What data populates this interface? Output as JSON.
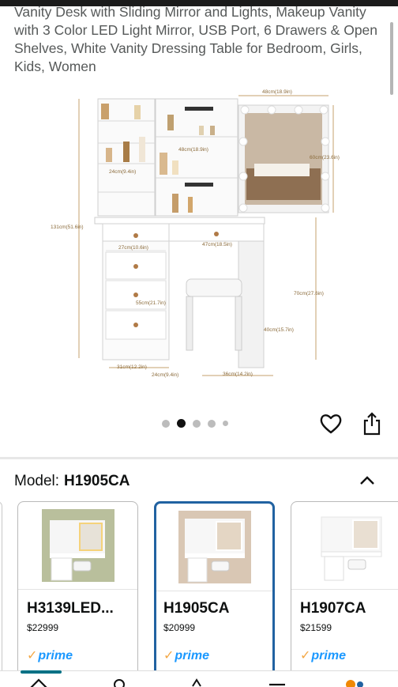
{
  "product": {
    "title": "Vanity Desk with Sliding Mirror and Lights, Makeup Vanity with 3 Color LED Light Mirror, USB Port, 6 Drawers & Open Shelves, White Vanity Dressing Table for Bedroom, Girls, Kids, Women"
  },
  "image_dimensions": {
    "top_width": "48cm(18.9in)",
    "mirror_height": "60cm(23.6in)",
    "shelf_width": "48cm(18.9in)",
    "shelf_depth": "24cm(9.4in)",
    "total_height": "131cm(51.6in)",
    "drawer_width": "27cm(10.6in)",
    "desk_drawer_width": "47cm(18.5in)",
    "desk_height": "70cm(27.6in)",
    "cabinet_height": "55cm(21.7in)",
    "stool_height": "40cm(15.7in)",
    "base_width": "31cm(12.2in)",
    "base_depth": "24cm(9.4in)",
    "stool_width": "36cm(14.2in)"
  },
  "carousel": {
    "count": 5,
    "active_index": 1
  },
  "actions": {
    "wishlist_icon": "heart-icon",
    "share_icon": "share-icon"
  },
  "model": {
    "label": "Model:",
    "value": "H1905CA"
  },
  "variants": [
    {
      "name": "H3139LED...",
      "price_whole": "$229",
      "price_fraction": "99",
      "prime": "prime",
      "selected": false
    },
    {
      "name": "H1905CA",
      "price_whole": "$209",
      "price_fraction": "99",
      "prime": "prime",
      "selected": true
    },
    {
      "name": "H1907CA",
      "price_whole": "$215",
      "price_fraction": "99",
      "prime": "prime",
      "selected": false
    }
  ],
  "colors": {
    "selected_border": "#2162a1",
    "prime_blue": "#1a98ff",
    "prime_check": "#f3a847"
  }
}
